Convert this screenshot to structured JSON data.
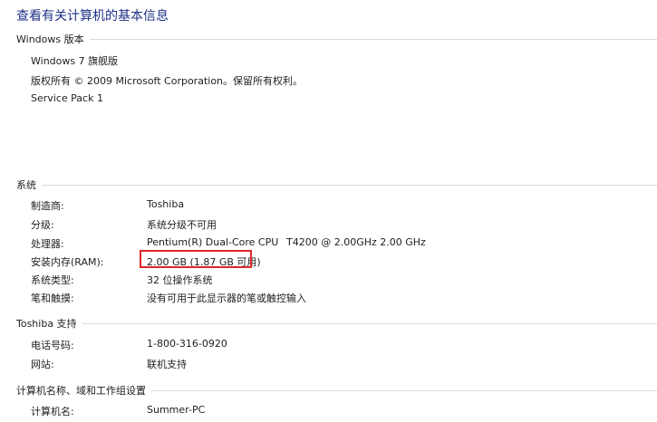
{
  "title": "查看有关计算机的基本信息",
  "windows_edition": {
    "header": "Windows 版本",
    "edition": "Windows 7 旗舰版",
    "copyright": "版权所有 © 2009 Microsoft Corporation。保留所有权利。",
    "service_pack": "Service Pack 1"
  },
  "system": {
    "header": "系统",
    "rows": [
      {
        "label": "制造商:",
        "value": "Toshiba"
      },
      {
        "label": "分级:",
        "value": "系统分级不可用"
      },
      {
        "label": "处理器:",
        "value": "Pentium(R) Dual-Core CPU",
        "value_extra": "T4200  @ 2.00GHz   2.00 GHz"
      },
      {
        "label": "安装内存(RAM):",
        "value": "2.00 GB (1.87 GB 可用)"
      },
      {
        "label": "系统类型:",
        "value": "32 位操作系统"
      },
      {
        "label": "笔和触摸:",
        "value": "没有可用于此显示器的笔或触控输入"
      }
    ]
  },
  "support": {
    "header": "Toshiba 支持",
    "rows": [
      {
        "label": "电话号码:",
        "value": "1-800-316-0920"
      },
      {
        "label": "网站:",
        "value": "联机支持"
      }
    ]
  },
  "computer": {
    "header": "计算机名称、域和工作组设置",
    "rows": [
      {
        "label": "计算机名:",
        "value": "Summer-PC"
      }
    ]
  },
  "colors": {
    "title": "#1e3287",
    "link": "#0066cc",
    "highlight": "#e0262a",
    "rule": "#d5dbe5"
  }
}
